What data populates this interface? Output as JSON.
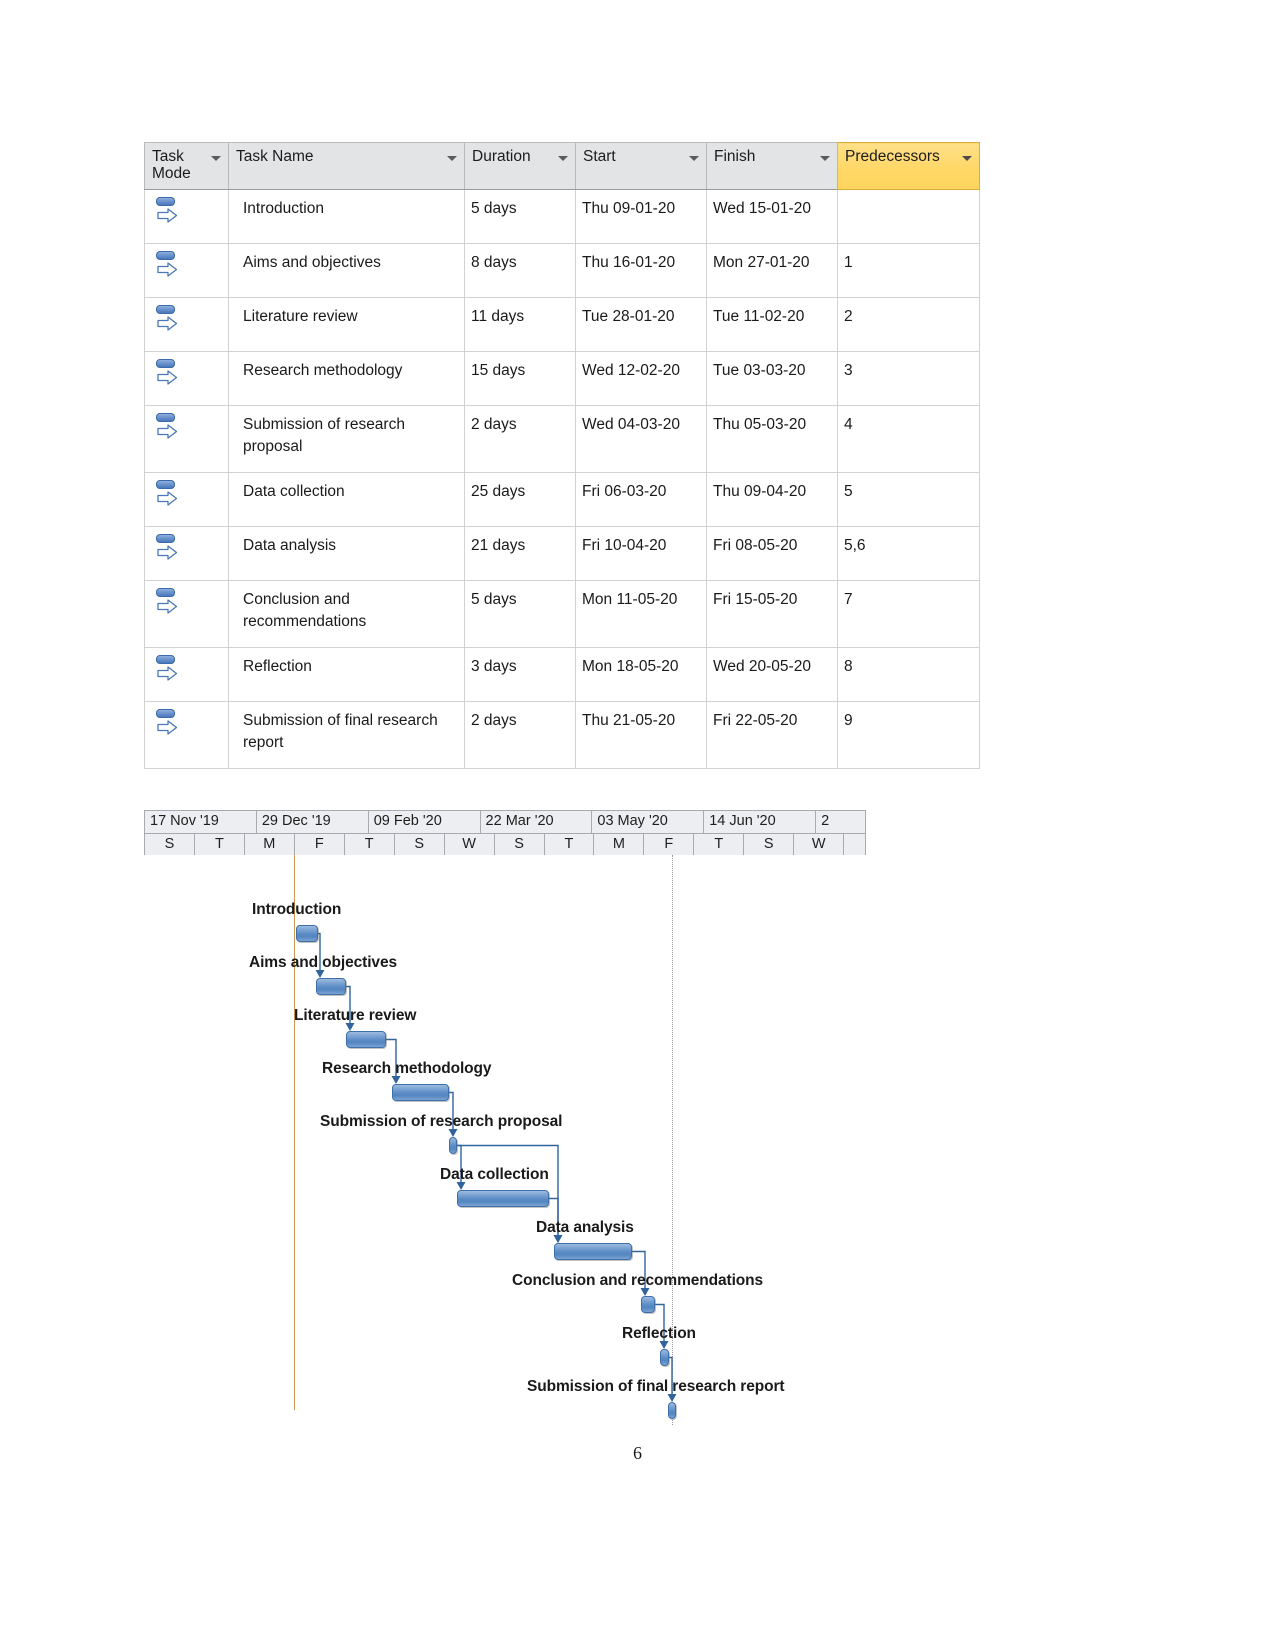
{
  "document": {
    "page_number": "6"
  },
  "task_table": {
    "columns": [
      {
        "key": "mode",
        "label": "Task Mode",
        "has_filter_arrow": true,
        "highlighted": false
      },
      {
        "key": "name",
        "label": "Task Name",
        "has_filter_arrow": true,
        "highlighted": false
      },
      {
        "key": "duration",
        "label": "Duration",
        "has_filter_arrow": true,
        "highlighted": false
      },
      {
        "key": "start",
        "label": "Start",
        "has_filter_arrow": true,
        "highlighted": false
      },
      {
        "key": "finish",
        "label": "Finish",
        "has_filter_arrow": true,
        "highlighted": false
      },
      {
        "key": "pred",
        "label": "Predecessors",
        "has_filter_arrow": true,
        "highlighted": true
      }
    ],
    "highlight_color": "#ffd766",
    "mode_icon": "manually-scheduled-icon",
    "rows": [
      {
        "name": "Introduction",
        "duration": "5 days",
        "start": "Thu 09-01-20",
        "finish": "Wed 15-01-20",
        "predecessors": ""
      },
      {
        "name": "Aims and objectives",
        "duration": "8 days",
        "start": "Thu 16-01-20",
        "finish": "Mon 27-01-20",
        "predecessors": "1"
      },
      {
        "name": "Literature review",
        "duration": "11 days",
        "start": "Tue 28-01-20",
        "finish": "Tue 11-02-20",
        "predecessors": "2"
      },
      {
        "name": "Research methodology",
        "duration": "15 days",
        "start": "Wed 12-02-20",
        "finish": "Tue 03-03-20",
        "predecessors": "3"
      },
      {
        "name": "Submission of research proposal",
        "duration": "2 days",
        "start": "Wed 04-03-20",
        "finish": "Thu 05-03-20",
        "predecessors": "4"
      },
      {
        "name": "Data collection",
        "duration": "25 days",
        "start": "Fri 06-03-20",
        "finish": "Thu 09-04-20",
        "predecessors": "5"
      },
      {
        "name": "Data analysis",
        "duration": "21 days",
        "start": "Fri 10-04-20",
        "finish": "Fri 08-05-20",
        "predecessors": "5,6"
      },
      {
        "name": "Conclusion and recommendations",
        "duration": "5 days",
        "start": "Mon 11-05-20",
        "finish": "Fri 15-05-20",
        "predecessors": "7"
      },
      {
        "name": "Reflection",
        "duration": "3 days",
        "start": "Mon 18-05-20",
        "finish": "Wed 20-05-20",
        "predecessors": "8"
      },
      {
        "name": "Submission of final research report",
        "duration": "2 days",
        "start": "Thu 21-05-20",
        "finish": "Fri 22-05-20",
        "predecessors": "9"
      }
    ]
  },
  "chart_data": {
    "type": "bar",
    "chart_kind": "gantt",
    "title": "",
    "xlabel": "",
    "ylabel": "",
    "grid": false,
    "legend": "none",
    "timeline": {
      "major_ticks": [
        "17 Nov '19",
        "29 Dec '19",
        "09 Feb '20",
        "22 Mar '20",
        "03 May '20",
        "14 Jun '20",
        "2"
      ],
      "minor_ticks": [
        "S",
        "T",
        "M",
        "F",
        "T",
        "S",
        "W",
        "S",
        "T",
        "M",
        "F",
        "T",
        "S",
        "W",
        ""
      ],
      "axis_range": [
        "17 Nov 2019",
        "Jun 2020"
      ]
    },
    "bars": [
      {
        "label": "Introduction",
        "start": "Thu 09-01-20",
        "finish": "Wed 15-01-20",
        "duration_days": 5
      },
      {
        "label": "Aims and objectives",
        "start": "Thu 16-01-20",
        "finish": "Mon 27-01-20",
        "duration_days": 8
      },
      {
        "label": "Literature review",
        "start": "Tue 28-01-20",
        "finish": "Tue 11-02-20",
        "duration_days": 11
      },
      {
        "label": "Research methodology",
        "start": "Wed 12-02-20",
        "finish": "Tue 03-03-20",
        "duration_days": 15
      },
      {
        "label": "Submission of research proposal",
        "start": "Wed 04-03-20",
        "finish": "Thu 05-03-20",
        "duration_days": 2
      },
      {
        "label": "Data collection",
        "start": "Fri 06-03-20",
        "finish": "Thu 09-04-20",
        "duration_days": 25
      },
      {
        "label": "Data analysis",
        "start": "Fri 10-04-20",
        "finish": "Fri 08-05-20",
        "duration_days": 21
      },
      {
        "label": "Conclusion and recommendations",
        "start": "Mon 11-05-20",
        "finish": "Fri 15-05-20",
        "duration_days": 5
      },
      {
        "label": "Reflection",
        "start": "Mon 18-05-20",
        "finish": "Wed 20-05-20",
        "duration_days": 3
      },
      {
        "label": "Submission of final research report",
        "start": "Thu 21-05-20",
        "finish": "Fri 22-05-20",
        "duration_days": 2
      }
    ],
    "bar_color": "#5d8cc6",
    "link_color": "#31639c"
  }
}
